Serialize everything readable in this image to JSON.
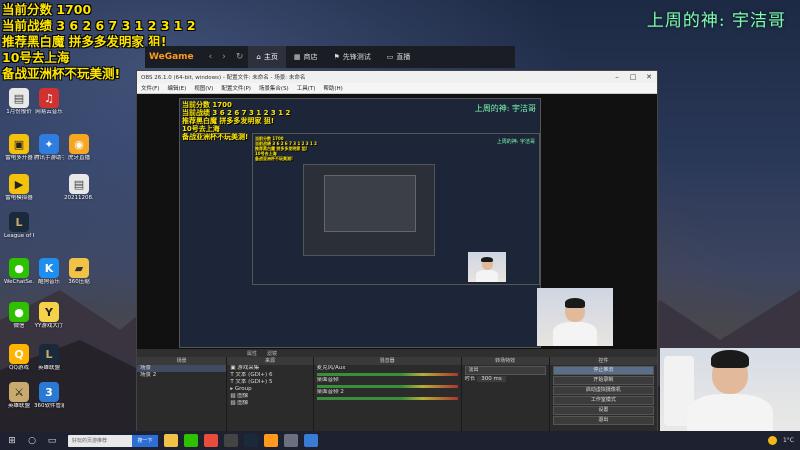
{
  "overlay_lines": [
    "当前分数 1700",
    "当前战绩 3 6 2 6 7 3 1 2 3 1 2",
    "推荐黑白魔  拼多多发明家 狙!",
    "10号去上海",
    "备战亚洲杯不玩美测!"
  ],
  "top_right_caption": "上周的神: 宇洁哥",
  "desktop_icons": [
    {
      "label": "1月份报价",
      "icon": "file-icon",
      "color": "#e8e8e8"
    },
    {
      "label": "网易云音乐",
      "icon": "netease-music-icon",
      "color": "#d0322f"
    },
    {
      "label": "雷电多开器",
      "icon": "ldplayer-multi-icon",
      "color": "#f4c20d"
    },
    {
      "label": "腾讯手游助手",
      "icon": "tencent-game-icon",
      "color": "#2f7de1"
    },
    {
      "label": "虎牙直播",
      "icon": "huya-icon",
      "color": "#f5a623"
    },
    {
      "label": "雷电模拟器",
      "icon": "ldplayer-icon",
      "color": "#f4c20d"
    },
    {
      "label": "20211208...",
      "icon": "file-icon",
      "color": "#e8e8e8"
    },
    {
      "label": "League of Legends",
      "icon": "lol-icon",
      "color": "#1a2a3a"
    },
    {
      "label": "WeChatSe...",
      "icon": "wechat-icon",
      "color": "#2dc100"
    },
    {
      "label": "酷狗音乐",
      "icon": "kugou-icon",
      "color": "#1f8ef1"
    },
    {
      "label": "360压缩",
      "icon": "folder-icon",
      "color": "#f1c248"
    },
    {
      "label": "微信",
      "icon": "wechat-icon",
      "color": "#2dc100"
    },
    {
      "label": "YY游戏大厅",
      "icon": "yy-icon",
      "color": "#f6d24a"
    },
    {
      "label": "QQ游戏",
      "icon": "qq-game-icon",
      "color": "#ffb400"
    },
    {
      "label": "英雄联盟",
      "icon": "lol-icon",
      "color": "#1a2a3a"
    },
    {
      "label": "英雄联盟",
      "icon": "lol-client-icon",
      "color": "#c8aa6e"
    },
    {
      "label": "360软件管家",
      "icon": "app-icon",
      "color": "#2a7ad5"
    }
  ],
  "wegame": {
    "logo": "WeGame",
    "tabs": [
      "主页",
      "商店",
      "先锋测试",
      "直播"
    ],
    "active_tab": 0
  },
  "obs": {
    "title": "OBS 26.1.0 (64-bit, windows) - 配置文件: 未命名 - 场景: 未命名",
    "menu": [
      "文件(F)",
      "编辑(E)",
      "视图(V)",
      "配置文件(P)",
      "场景集合(S)",
      "工具(T)",
      "帮助(H)"
    ],
    "toolbar": [
      "属性",
      "滤镜"
    ],
    "docks": {
      "scenes": {
        "header": "场景",
        "items": [
          "场景",
          "场景 2"
        ]
      },
      "sources": {
        "header": "来源",
        "items": [
          "游戏采集",
          "文本 (GDI+) 6",
          "文本 (GDI+) 5",
          "Group",
          "图像",
          "图像"
        ]
      },
      "mixer": {
        "header": "混音器",
        "items": [
          "麦克风/Aux",
          "桌面音频",
          "桌面音频 2"
        ]
      },
      "transitions": {
        "header": "转场特效",
        "type": "淡出",
        "duration_label": "时长",
        "duration": "300 ms"
      },
      "controls": {
        "header": "控件",
        "buttons": [
          "停止推流",
          "开始录制",
          "启动虚拟摄像机",
          "工作室模式",
          "设置",
          "退出"
        ]
      }
    }
  },
  "taskbar": {
    "search_placeholder": "好玩的页游推荐",
    "search_button": "搜一下",
    "temperature": "1°C"
  }
}
